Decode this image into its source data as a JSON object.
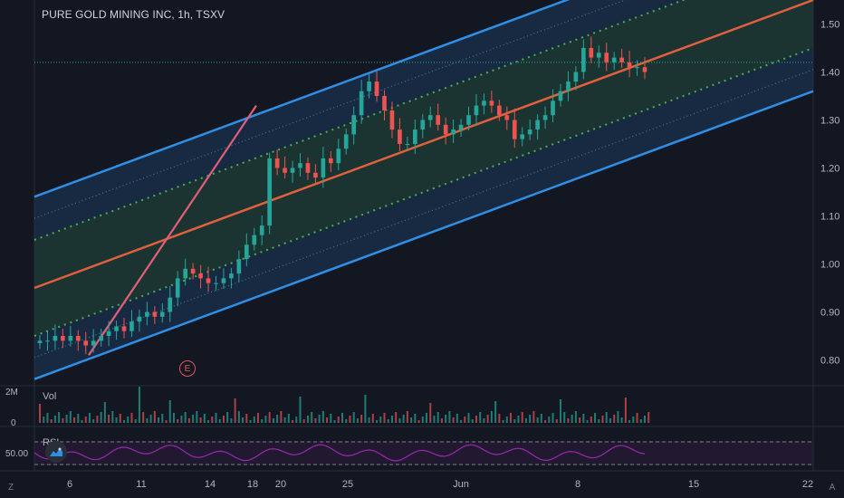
{
  "header": {
    "title": "PURE GOLD MINING INC, 1h, TSXV"
  },
  "price_axis": {
    "ticks": [
      "1.50",
      "1.40",
      "1.30",
      "1.20",
      "1.10",
      "1.00",
      "0.90",
      "0.80"
    ]
  },
  "volume_pane": {
    "label": "Vol",
    "ticks": [
      "2M",
      "0"
    ]
  },
  "rsi_pane": {
    "label": "RSI",
    "tick": "50.00"
  },
  "time_axis": {
    "ticks": [
      "6",
      "11",
      "14",
      "18",
      "20",
      "25",
      "Jun",
      "8",
      "15",
      "22"
    ]
  },
  "earnings_marker": {
    "label": "E"
  },
  "corner_buttons": {
    "left": "Z",
    "right": "A"
  },
  "colors": {
    "background": "#131722",
    "channel_outer": "#2f8fe6",
    "channel_mid": "#e0603e",
    "dotted_green": "#4caf50",
    "dotted_blue": "#3a78b0",
    "candle_up": "#26a69a",
    "candle_down": "#ef5350",
    "rsi_line": "#9c27b0",
    "earnings": "#e0545c"
  },
  "chart_data": {
    "type": "candlestick",
    "title": "PURE GOLD MINING INC, 1h, TSXV",
    "ylim": [
      0.75,
      1.55
    ],
    "last_price_line": 1.42,
    "channel": {
      "start_mid": 0.95,
      "end_mid": 1.55,
      "upper_offset": 0.19,
      "lower_offset": -0.19
    },
    "closes": [
      0.84,
      0.84,
      0.85,
      0.84,
      0.85,
      0.84,
      0.83,
      0.84,
      0.85,
      0.86,
      0.87,
      0.86,
      0.88,
      0.89,
      0.9,
      0.89,
      0.9,
      0.93,
      0.97,
      0.99,
      0.98,
      0.97,
      0.96,
      0.96,
      0.97,
      0.98,
      1.01,
      1.04,
      1.06,
      1.08,
      1.22,
      1.2,
      1.19,
      1.2,
      1.21,
      1.19,
      1.18,
      1.22,
      1.21,
      1.24,
      1.27,
      1.31,
      1.36,
      1.38,
      1.35,
      1.32,
      1.28,
      1.25,
      1.25,
      1.28,
      1.3,
      1.31,
      1.29,
      1.27,
      1.28,
      1.29,
      1.31,
      1.33,
      1.34,
      1.33,
      1.31,
      1.3,
      1.26,
      1.27,
      1.28,
      1.3,
      1.31,
      1.34,
      1.36,
      1.38,
      1.4,
      1.45,
      1.43,
      1.44,
      1.42,
      1.43,
      1.42,
      1.41,
      1.41,
      1.4
    ]
  }
}
